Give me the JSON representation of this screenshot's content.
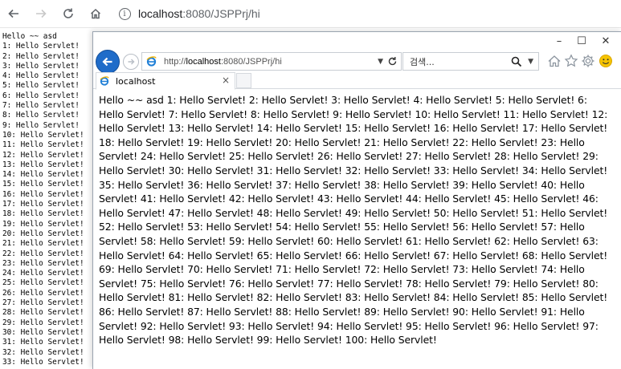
{
  "chrome": {
    "url_host": "localhost",
    "url_rest": ":8080/JSPPrj/hi"
  },
  "background_page": {
    "lines": [
      "Hello ~~ asd",
      "1: Hello Servlet!",
      "2: Hello Servlet!",
      "3: Hello Servlet!",
      "4: Hello Servlet!",
      "5: Hello Servlet!",
      "6: Hello Servlet!",
      "7: Hello Servlet!",
      "8: Hello Servlet!",
      "9: Hello Servlet!",
      "10: Hello Servlet!",
      "11: Hello Servlet!",
      "12: Hello Servlet!",
      "13: Hello Servlet!",
      "14: Hello Servlet!",
      "15: Hello Servlet!",
      "16: Hello Servlet!",
      "17: Hello Servlet!",
      "18: Hello Servlet!",
      "19: Hello Servlet!",
      "20: Hello Servlet!",
      "21: Hello Servlet!",
      "22: Hello Servlet!",
      "23: Hello Servlet!",
      "24: Hello Servlet!",
      "25: Hello Servlet!",
      "26: Hello Servlet!",
      "27: Hello Servlet!",
      "28: Hello Servlet!",
      "29: Hello Servlet!",
      "30: Hello Servlet!",
      "31: Hello Servlet!",
      "32: Hello Servlet!",
      "33: Hello Servlet!"
    ]
  },
  "ie": {
    "window_controls": {
      "minimize": "–",
      "maximize": "☐",
      "close": "✕"
    },
    "address_prefix": "http://",
    "address_host": "localhost",
    "address_rest": ":8080/JSPPrj/hi",
    "search_placeholder": "검색...",
    "tab_label": "localhost",
    "tab_close": "×",
    "content": "Hello ~~ asd 1: Hello Servlet! 2: Hello Servlet! 3: Hello Servlet! 4: Hello Servlet! 5: Hello Servlet! 6: Hello Servlet! 7: Hello Servlet! 8: Hello Servlet! 9: Hello Servlet! 10: Hello Servlet! 11: Hello Servlet! 12: Hello Servlet! 13: Hello Servlet! 14: Hello Servlet! 15: Hello Servlet! 16: Hello Servlet! 17: Hello Servlet! 18: Hello Servlet! 19: Hello Servlet! 20: Hello Servlet! 21: Hello Servlet! 22: Hello Servlet! 23: Hello Servlet! 24: Hello Servlet! 25: Hello Servlet! 26: Hello Servlet! 27: Hello Servlet! 28: Hello Servlet! 29: Hello Servlet! 30: Hello Servlet! 31: Hello Servlet! 32: Hello Servlet! 33: Hello Servlet! 34: Hello Servlet! 35: Hello Servlet! 36: Hello Servlet! 37: Hello Servlet! 38: Hello Servlet! 39: Hello Servlet! 40: Hello Servlet! 41: Hello Servlet! 42: Hello Servlet! 43: Hello Servlet! 44: Hello Servlet! 45: Hello Servlet! 46: Hello Servlet! 47: Hello Servlet! 48: Hello Servlet! 49: Hello Servlet! 50: Hello Servlet! 51: Hello Servlet! 52: Hello Servlet! 53: Hello Servlet! 54: Hello Servlet! 55: Hello Servlet! 56: Hello Servlet! 57: Hello Servlet! 58: Hello Servlet! 59: Hello Servlet! 60: Hello Servlet! 61: Hello Servlet! 62: Hello Servlet! 63: Hello Servlet! 64: Hello Servlet! 65: Hello Servlet! 66: Hello Servlet! 67: Hello Servlet! 68: Hello Servlet! 69: Hello Servlet! 70: Hello Servlet! 71: Hello Servlet! 72: Hello Servlet! 73: Hello Servlet! 74: Hello Servlet! 75: Hello Servlet! 76: Hello Servlet! 77: Hello Servlet! 78: Hello Servlet! 79: Hello Servlet! 80: Hello Servlet! 81: Hello Servlet! 82: Hello Servlet! 83: Hello Servlet! 84: Hello Servlet! 85: Hello Servlet! 86: Hello Servlet! 87: Hello Servlet! 88: Hello Servlet! 89: Hello Servlet! 90: Hello Servlet! 91: Hello Servlet! 92: Hello Servlet! 93: Hello Servlet! 94: Hello Servlet! 95: Hello Servlet! 96: Hello Servlet! 97: Hello Servlet! 98: Hello Servlet! 99: Hello Servlet! 100: Hello Servlet!"
  },
  "colors": {
    "ie_accent": "#1f6cc9",
    "smiley": "#f6c400"
  }
}
